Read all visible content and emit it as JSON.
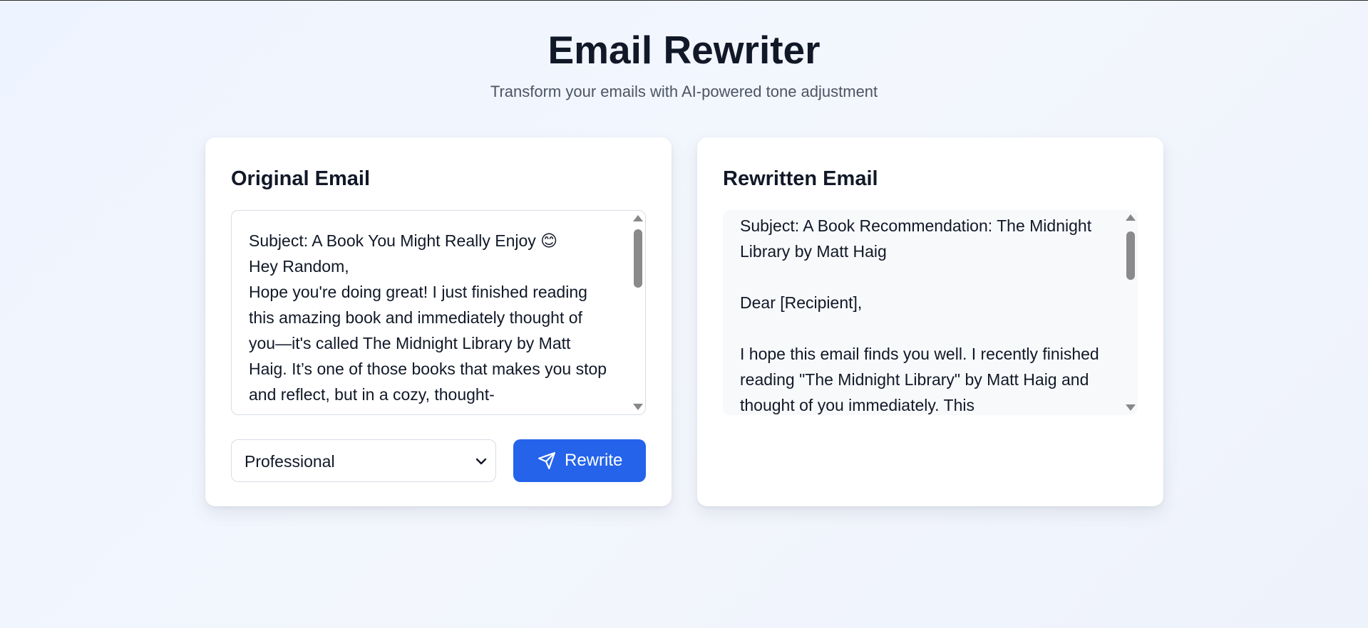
{
  "app": {
    "title": "Email Rewriter",
    "subtitle": "Transform your emails with AI-powered tone adjustment"
  },
  "original": {
    "heading": "Original Email",
    "text": "Subject: A Book You Might Really Enjoy 😊\nHey Random,\nHope you're doing great! I just finished reading this amazing book and immediately thought of you—it's called The Midnight Library by Matt Haig. It’s one of those books that makes you stop and reflect, but in a cozy, thought-"
  },
  "tone_select": {
    "value": "Professional"
  },
  "rewrite_button": {
    "label": "Rewrite",
    "icon": "send-icon"
  },
  "rewritten": {
    "heading": "Rewritten Email",
    "text": "Subject: A Book Recommendation: The Midnight Library by Matt Haig\n\nDear [Recipient],\n\nI hope this email finds you well. I recently finished reading \"The Midnight Library\" by Matt Haig and thought of you immediately. This"
  },
  "colors": {
    "accent": "#2563eb",
    "background": "#eef4ff",
    "card": "#ffffff",
    "output_bg": "#f8f9fb"
  }
}
